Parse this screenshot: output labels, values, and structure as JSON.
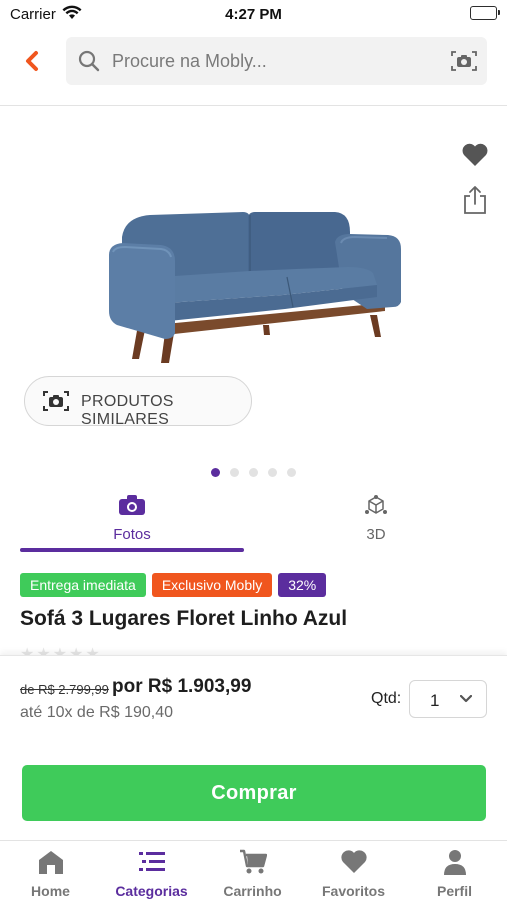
{
  "status_bar": {
    "carrier": "Carrier",
    "time": "4:27 PM"
  },
  "search": {
    "placeholder": "Procure na Mobly..."
  },
  "similar": {
    "label": "PRODUTOS SIMILARES"
  },
  "gallery": {
    "dot_count": 5,
    "active_index": 0
  },
  "view_tabs": [
    {
      "label": "Fotos",
      "active": true,
      "icon": "camera-icon"
    },
    {
      "label": "3D",
      "active": false,
      "icon": "cube-3d-icon"
    }
  ],
  "badges": [
    {
      "label": "Entrega imediata",
      "color": "#3fcb5a"
    },
    {
      "label": "Exclusivo Mobly",
      "color": "#f0561e"
    },
    {
      "label": "32%",
      "color": "#5b2d9e"
    }
  ],
  "product": {
    "title": "Sofá 3 Lugares Floret Linho Azul",
    "rating_stars": 5
  },
  "price": {
    "old": "de R$ 2.799,99",
    "new": "por R$ 1.903,99",
    "installments": "até 10x de R$ 190,40"
  },
  "quantity": {
    "label": "Qtd:",
    "value": "1"
  },
  "buy_button": {
    "label": "Comprar",
    "color": "#3fcb5a"
  },
  "bottom_nav": [
    {
      "label": "Home",
      "icon": "home-icon",
      "active": false
    },
    {
      "label": "Categorias",
      "icon": "categories-icon",
      "active": true
    },
    {
      "label": "Carrinho",
      "icon": "cart-icon",
      "active": false
    },
    {
      "label": "Favoritos",
      "icon": "heart-icon",
      "active": false
    },
    {
      "label": "Perfil",
      "icon": "user-icon",
      "active": false
    }
  ],
  "colors": {
    "accent": "#5b2d9e",
    "back_arrow": "#f0561e",
    "green": "#3fcb5a"
  }
}
